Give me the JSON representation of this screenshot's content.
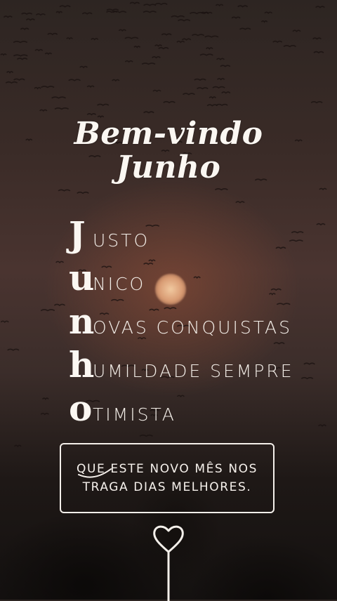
{
  "title": {
    "line1": "Bem-vindo",
    "line2": "Junho"
  },
  "acrostic": [
    {
      "initial": "J",
      "rest": "USTO"
    },
    {
      "initial": "u",
      "rest": "NICO"
    },
    {
      "initial": "n",
      "rest": "OVAS CONQUISTAS"
    },
    {
      "initial": "h",
      "rest": "UMILDADE SEMPRE"
    },
    {
      "initial": "o",
      "rest": "TIMISTA"
    }
  ],
  "quote": {
    "line1": "QUE ESTE NOVO MÊS NOS",
    "line2": "TRAGA DIAS MELHORES."
  },
  "colors": {
    "text": "#fbf7f2",
    "box_border": "#f3efea",
    "sun": "#e0a57c"
  },
  "icons": {
    "heart": "heart-icon"
  }
}
